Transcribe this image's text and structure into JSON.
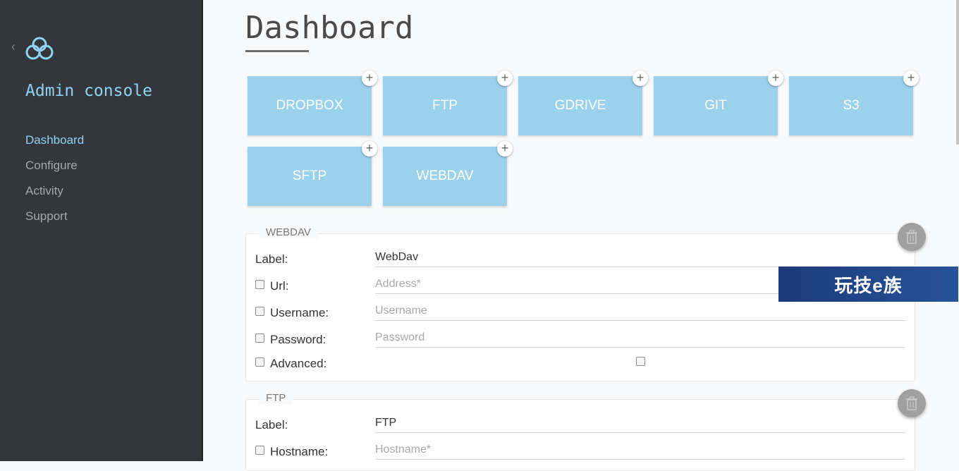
{
  "sidebar": {
    "brand": "Admin console",
    "nav": [
      "Dashboard",
      "Configure",
      "Activity",
      "Support"
    ],
    "active": "Dashboard"
  },
  "main": {
    "title": "Dashboard",
    "tiles": [
      {
        "label": "DROPBOX",
        "add": "+"
      },
      {
        "label": "FTP",
        "add": "+"
      },
      {
        "label": "GDRIVE",
        "add": "+"
      },
      {
        "label": "GIT",
        "add": "+"
      },
      {
        "label": "S3",
        "add": "+"
      },
      {
        "label": "SFTP",
        "add": "+"
      },
      {
        "label": "WEBDAV",
        "add": "+"
      }
    ],
    "webdav": {
      "legend": "WEBDAV",
      "label_text": "Label:",
      "label_value": "WebDav",
      "url_text": "Url:",
      "url_placeholder": "Address*",
      "username_text": "Username:",
      "username_placeholder": "Username",
      "password_text": "Password:",
      "password_placeholder": "Password",
      "advanced_text": "Advanced:"
    },
    "ftp": {
      "legend": "FTP",
      "label_text": "Label:",
      "label_value": "FTP",
      "hostname_text": "Hostname:",
      "hostname_placeholder": "Hostname*"
    }
  },
  "watermark": "玩技e族",
  "colors": {
    "sidebar_bg": "#33373b",
    "accent": "#8fd2f2",
    "tile_bg": "#9ad2ec"
  }
}
